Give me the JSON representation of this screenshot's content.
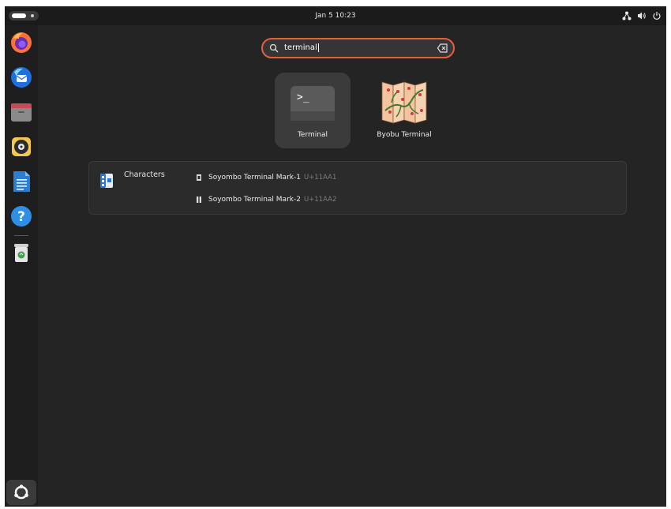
{
  "topbar": {
    "clock": "Jan 5  10:23",
    "tray_icons": [
      "network-icon",
      "volume-icon",
      "power-icon"
    ]
  },
  "dock": {
    "items": [
      {
        "name": "firefox"
      },
      {
        "name": "thunderbird"
      },
      {
        "name": "files"
      },
      {
        "name": "rhythmbox"
      },
      {
        "name": "libreoffice-writer"
      },
      {
        "name": "help"
      },
      {
        "name": "trash"
      }
    ],
    "show_apps": "show-apps-icon"
  },
  "search": {
    "value": "terminal",
    "accent_color": "#e4603c"
  },
  "app_results": [
    {
      "label": "Terminal",
      "selected": true
    },
    {
      "label": "Byobu Terminal",
      "selected": false
    }
  ],
  "provider": {
    "name": "Characters",
    "results": [
      {
        "title": "Soyombo Terminal Mark-1",
        "code": "U+11AA1"
      },
      {
        "title": "Soyombo Terminal Mark-2",
        "code": "U+11AA2"
      }
    ]
  }
}
